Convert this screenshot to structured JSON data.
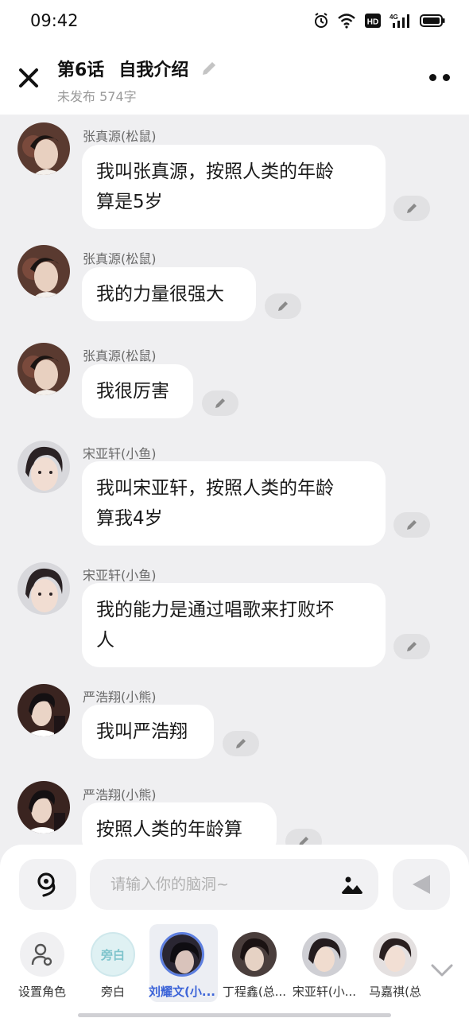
{
  "status_bar": {
    "time": "09:42",
    "hd_label": "HD",
    "network_label": "4G"
  },
  "header": {
    "episode": "第6话",
    "title": "自我介绍",
    "subtitle": "未发布 574字"
  },
  "messages": [
    {
      "sender": "张真源(松鼠)",
      "text": "我叫张真源，按照人类的年龄\n算是5岁"
    },
    {
      "sender": "张真源(松鼠)",
      "text": "我的力量很强大"
    },
    {
      "sender": "张真源(松鼠)",
      "text": "我很厉害"
    },
    {
      "sender": "宋亚轩(小鱼)",
      "text": "我叫宋亚轩，按照人类的年龄\n算我4岁"
    },
    {
      "sender": "宋亚轩(小鱼)",
      "text": "我的能力是通过唱歌来打败坏\n人"
    },
    {
      "sender": "严浩翔(小熊)",
      "text": "我叫严浩翔"
    },
    {
      "sender": "严浩翔(小熊)",
      "text": "按照人类的年龄算"
    }
  ],
  "composer": {
    "placeholder": "请输入你的脑洞~"
  },
  "roles": [
    {
      "label": "设置角色"
    },
    {
      "label": "旁白",
      "avatar_text": "旁白"
    },
    {
      "label": "刘耀文(小...",
      "selected": true
    },
    {
      "label": "丁程鑫(总..."
    },
    {
      "label": "宋亚轩(小..."
    },
    {
      "label": "马嘉祺(总"
    }
  ],
  "colors": {
    "accent": "#3c64d8",
    "bubble": "#ffffff",
    "background": "#efeff1"
  }
}
